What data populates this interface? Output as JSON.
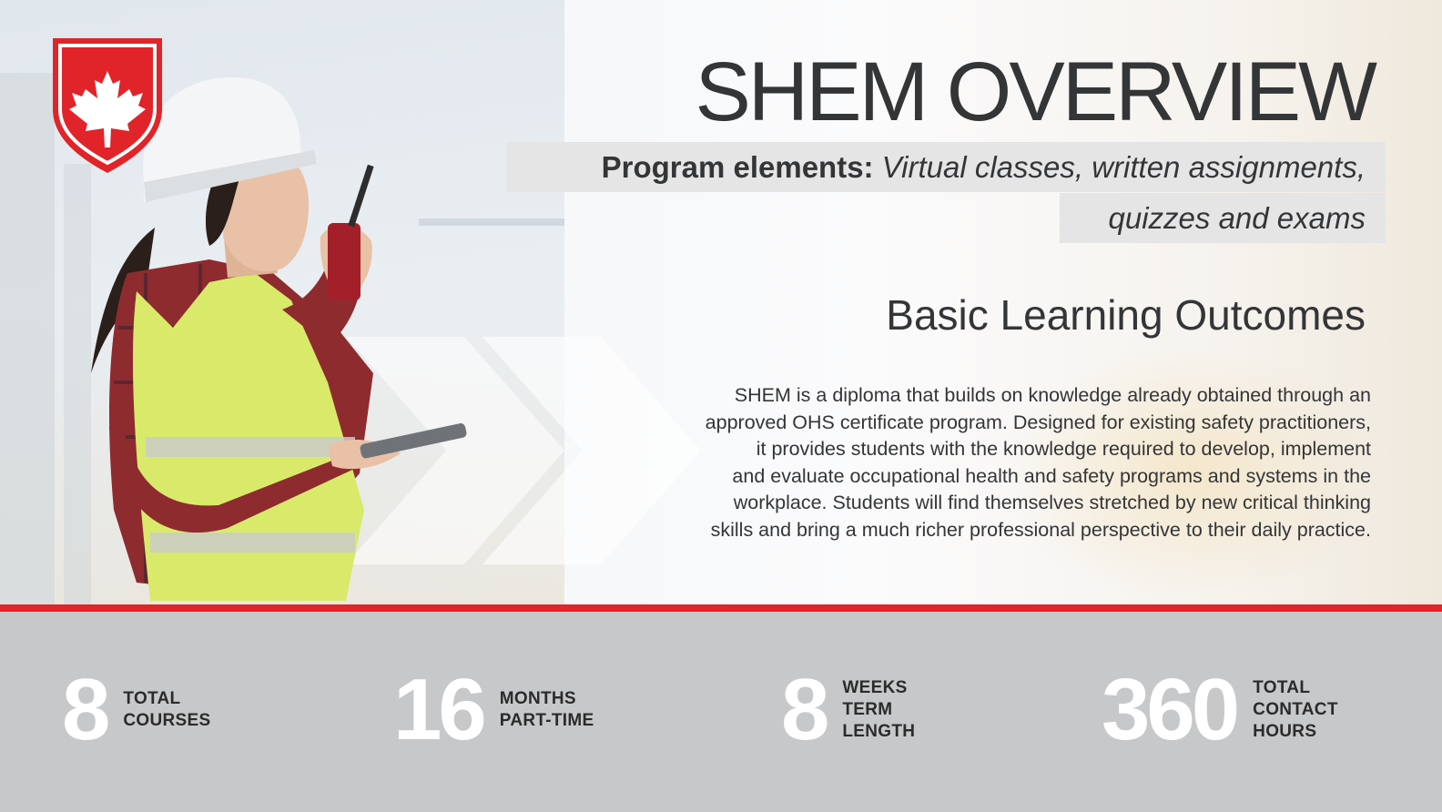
{
  "title": "SHEM OVERVIEW",
  "program_elements": {
    "label": "Program elements:",
    "line1": "Virtual classes, written assignments,",
    "line2": "quizzes and exams"
  },
  "subtitle": "Basic Learning Outcomes",
  "paragraph_lines": [
    "SHEM is a diploma that builds on knowledge already obtained through an",
    "approved OHS certificate program. Designed for existing safety practitioners,",
    "it provides students with the knowledge required to develop, implement",
    "and evaluate occupational health and safety programs and systems in the",
    "workplace. Students will find themselves stretched by new critical thinking",
    "skills and bring a much richer professional perspective to their daily practice."
  ],
  "stats": [
    {
      "value": "8",
      "label_lines": [
        "TOTAL",
        "COURSES"
      ]
    },
    {
      "value": "16",
      "label_lines": [
        "MONTHS",
        "PART-TIME"
      ]
    },
    {
      "value": "8",
      "label_lines": [
        "WEEKS",
        "TERM",
        "LENGTH"
      ]
    },
    {
      "value": "360",
      "label_lines": [
        "TOTAL",
        "CONTACT",
        "HOURS"
      ]
    }
  ],
  "colors": {
    "accent_red": "#e12429",
    "stats_band": "#c7c8ca",
    "text_dark": "#333537"
  },
  "icons": {
    "logo": "maple-leaf-shield-icon",
    "photo": "safety-worker-photo"
  }
}
